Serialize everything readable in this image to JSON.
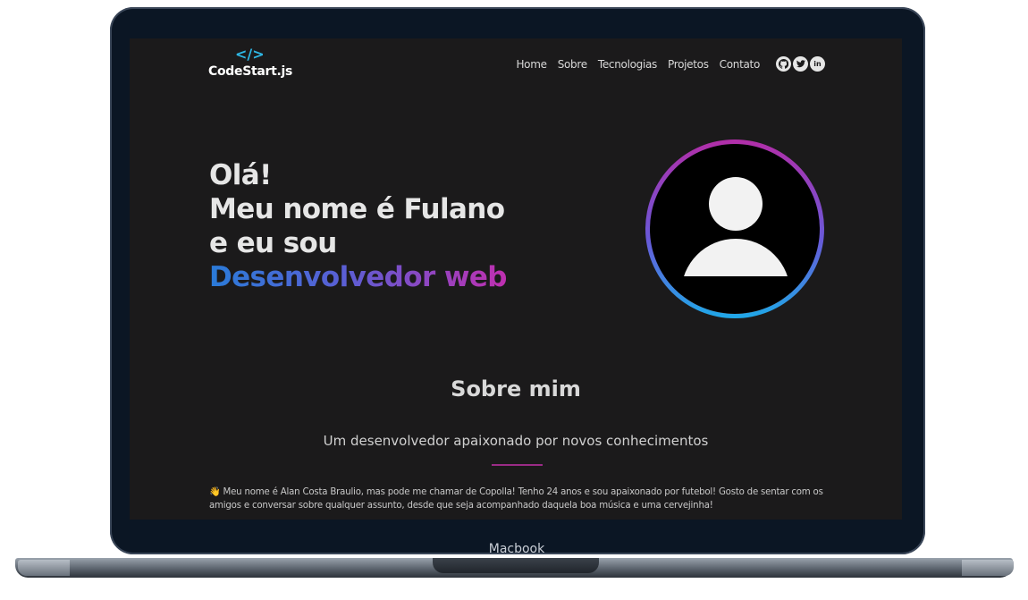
{
  "device": {
    "label": "Macbook"
  },
  "header": {
    "logo_mark": "</>",
    "logo_text": "CodeStart.js",
    "nav": [
      "Home",
      "Sobre",
      "Tecnologias",
      "Projetos",
      "Contato"
    ],
    "social_icons": [
      "github-icon",
      "twitter-icon",
      "linkedin-icon"
    ]
  },
  "hero": {
    "line1": "Olá!",
    "line2": "Meu nome é Fulano",
    "line3": "e eu sou",
    "highlight": "Desenvolvedor web"
  },
  "about": {
    "title": "Sobre mim",
    "subtitle": "Um desenvolvedor apaixonado por novos conhecimentos",
    "text": "👋 Meu nome é Alan Costa Braulio, mas pode me chamar de Copolla! Tenho 24 anos e sou apaixonado por futebol! Gosto de sentar com os amigos e conversar sobre qualquer assunto, desde que seja acompanhado daquela boa música e uma cervejinha!"
  },
  "colors": {
    "background": "#1b1a1b",
    "accent_blue": "#2a7bd8",
    "accent_magenta": "#c02fb0",
    "logo": "#2eb8e6"
  }
}
